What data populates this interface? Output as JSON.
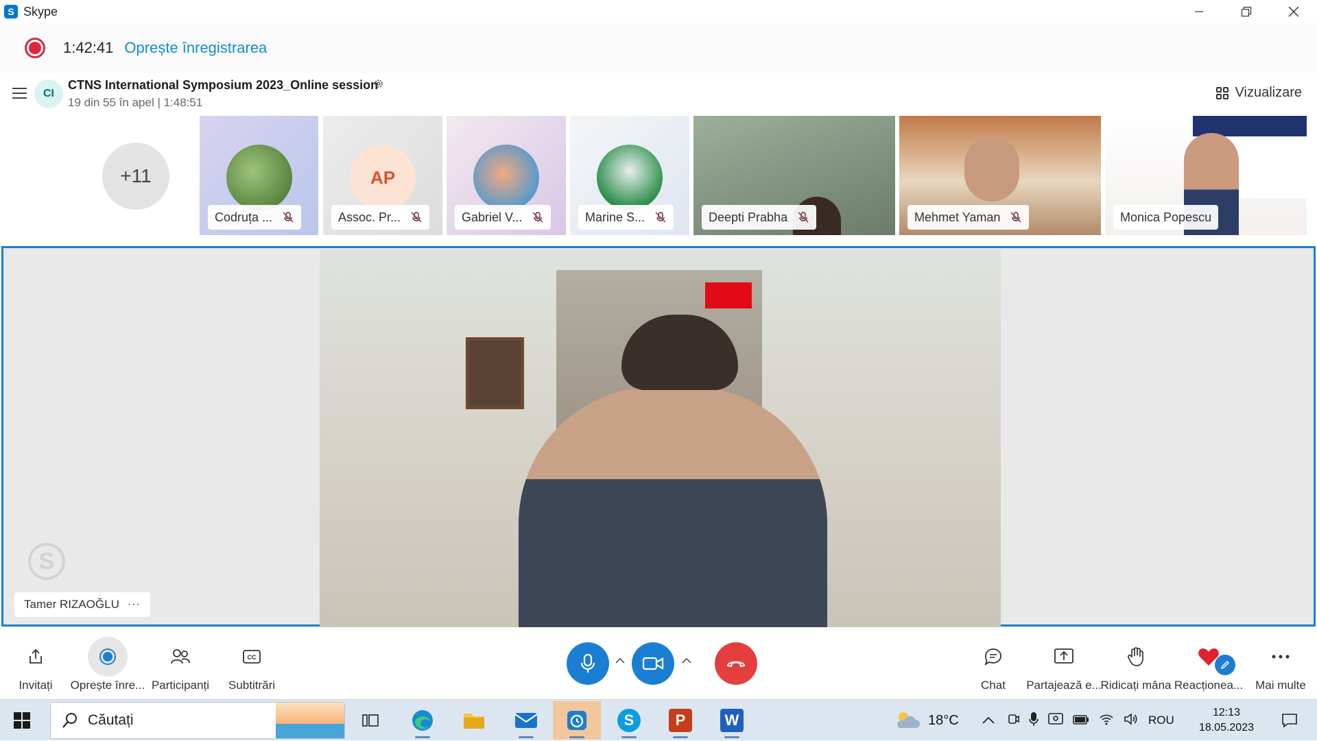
{
  "window": {
    "app_title": "Skype",
    "logo_letter": "S"
  },
  "recording": {
    "elapsed": "1:42:41",
    "stop_label": "Oprește înregistrarea"
  },
  "call": {
    "avatar_initials": "CI",
    "title": "CTNS International Symposium 2023_Online session",
    "subtitle": "19 din 55 în apel | 1:48:51",
    "view_label": "Vizualizare"
  },
  "participants": {
    "overflow_count": "+11",
    "tiles": [
      {
        "name": "Codruța ...",
        "muted": true
      },
      {
        "name": "Assoc. Pr...",
        "initials": "AP",
        "muted": true
      },
      {
        "name": "Gabriel V...",
        "muted": true
      },
      {
        "name": "Marine S...",
        "muted": true
      },
      {
        "name": "Deepti Prabha",
        "muted": true
      },
      {
        "name": "Mehmet Yaman",
        "muted": true
      },
      {
        "name": "Monica Popescu",
        "muted": false
      }
    ]
  },
  "main_speaker": {
    "name": "Tamer RIZAOĞLU",
    "more": "···",
    "watermark_letter": "S"
  },
  "controls": {
    "invite": "Invitați",
    "stop_recording": "Oprește înre...",
    "participants": "Participanți",
    "captions": "Subtitrări",
    "chat": "Chat",
    "share": "Partajează e...",
    "raise_hand": "Ridicați mâna",
    "react": "Reacționea...",
    "more": "Mai multe"
  },
  "taskbar": {
    "search_placeholder": "Căutați",
    "weather": "18°C",
    "language": "ROU",
    "time": "12:13",
    "date": "18.05.2023",
    "powerpoint_letter": "P",
    "word_letter": "W",
    "skype_letter": "S"
  },
  "colors": {
    "accent_blue": "#1a7fd3",
    "record_red": "#e3253a",
    "link_blue": "#0f8fd1",
    "hangup_red": "#e53e3e",
    "react_heart": "#e02130"
  }
}
